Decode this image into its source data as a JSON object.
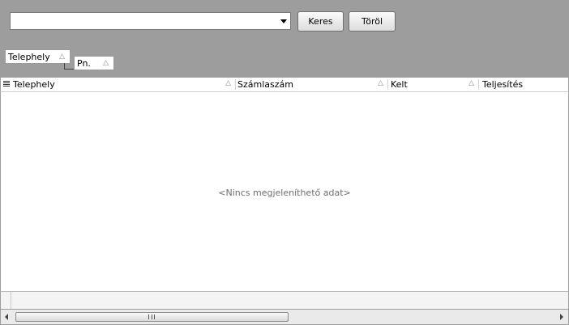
{
  "toolbar": {
    "combo_value": "",
    "search_label": "Keres",
    "clear_label": "Töröl"
  },
  "group_by": [
    {
      "label": "Telephely"
    },
    {
      "label": "Pn."
    }
  ],
  "grid": {
    "columns": [
      {
        "label": "Telephely"
      },
      {
        "label": "Számlaszám"
      },
      {
        "label": "Kelt"
      },
      {
        "label": "Teljesítés"
      }
    ],
    "empty_text": "<Nincs megjeleníthető adat>"
  },
  "icons": {
    "sort": "sort-asc-icon",
    "combo": "chevron-down-icon",
    "row_selector": "row-selector-icon"
  },
  "colors": {
    "panel_bg": "#9d9d9d",
    "empty_text": "#6e6e6e"
  }
}
